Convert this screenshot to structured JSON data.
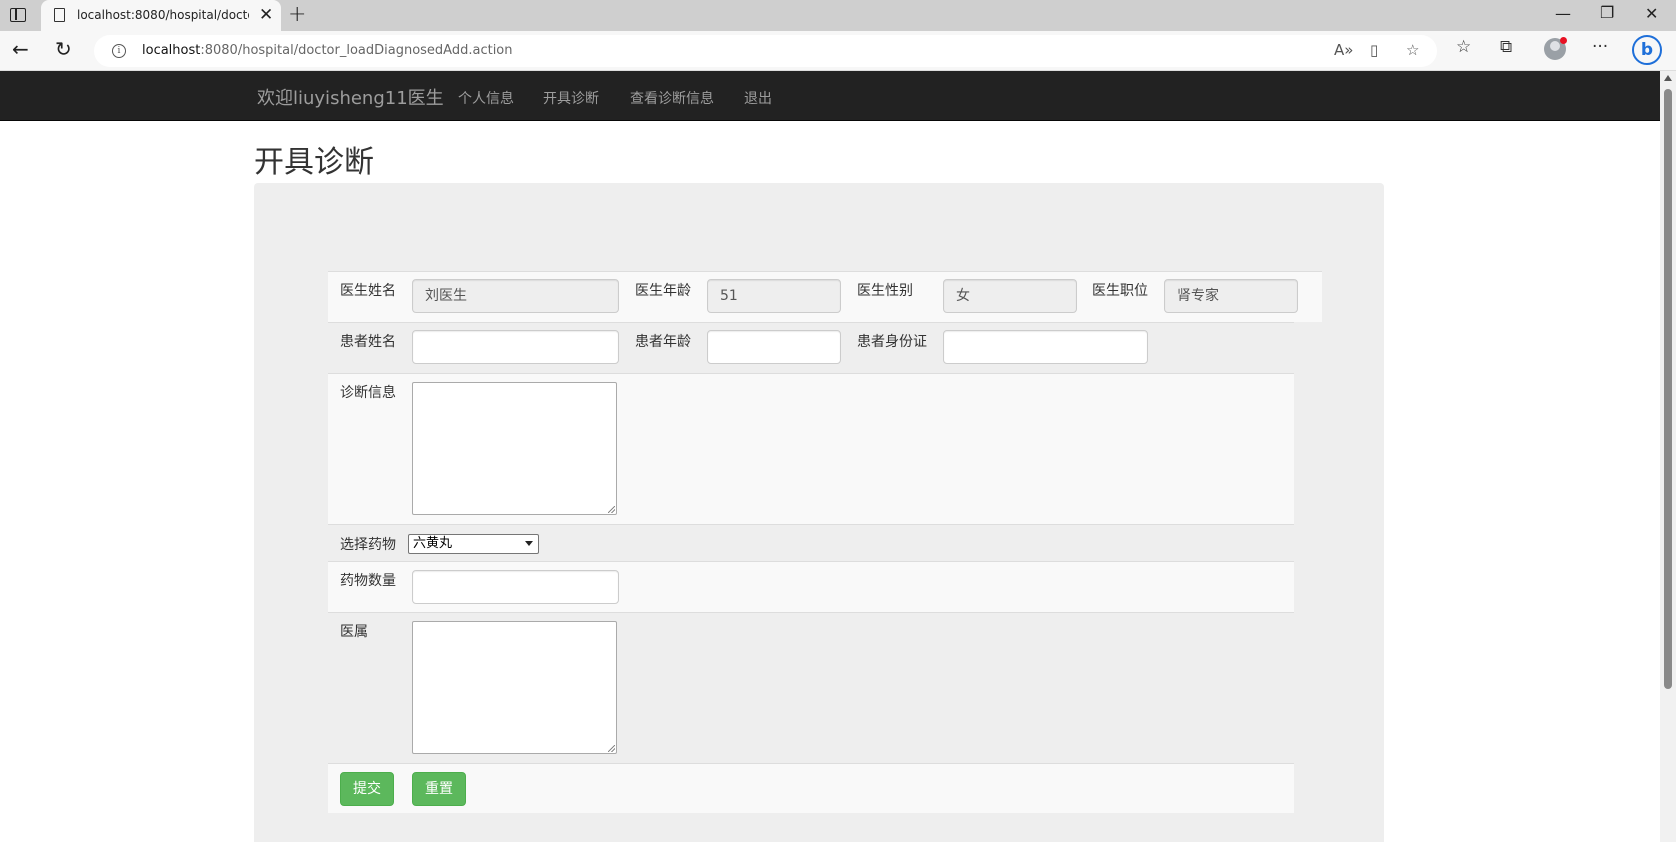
{
  "browser": {
    "tab_title": "localhost:8080/hospital/doctor_loadDiagnosedAdd.action",
    "url_host": "localhost",
    "url_rest": ":8080/hospital/doctor_loadDiagnosedAdd.action"
  },
  "navbar": {
    "brand": "欢迎liuyisheng11医生",
    "links": [
      "个人信息",
      "开具诊断",
      "查看诊断信息",
      "退出"
    ]
  },
  "page": {
    "title": "开具诊断"
  },
  "form": {
    "doctor_name_label": "医生姓名",
    "doctor_name_value": "刘医生",
    "doctor_age_label": "医生年龄",
    "doctor_age_value": "51",
    "doctor_gender_label": "医生性别",
    "doctor_gender_value": "女",
    "doctor_title_label": "医生职位",
    "doctor_title_value": "肾专家",
    "patient_name_label": "患者姓名",
    "patient_age_label": "患者年龄",
    "patient_id_label": "患者身份证",
    "diagnosis_label": "诊断信息",
    "medicine_label": "选择药物",
    "medicine_selected": "六黄丸",
    "quantity_label": "药物数量",
    "advice_label": "医属",
    "submit_label": "提交",
    "reset_label": "重置"
  }
}
